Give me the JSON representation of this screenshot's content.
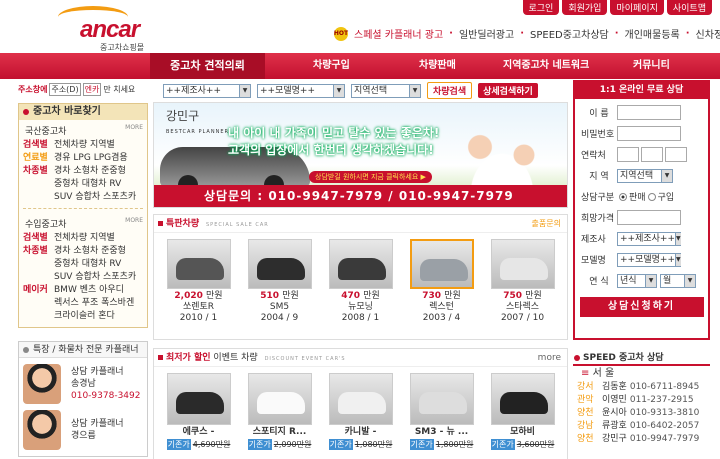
{
  "top_links": [
    "로그인",
    "회원가입",
    "마이페이지",
    "사이트맵"
  ],
  "logo": {
    "word": "ancar",
    "sub": "중고차쇼핑몰"
  },
  "header_links": {
    "hot_badge": "HOT",
    "special": "스페셜 카플래너 광고",
    "dealer": "일반딜러광고",
    "speed": "SPEED중고차상담",
    "personal": "개인매물등록",
    "newcar": "신차정보"
  },
  "nav": [
    "중고차 견적의뢰",
    "차량구입",
    "차량판매",
    "지역중고차 네트워크",
    "커뮤니티"
  ],
  "address_search": {
    "label": "주소창에",
    "tab1": "주소(D)",
    "name": "엔카",
    "tail": "만 치세요"
  },
  "left_panel": {
    "title": "중고차 바로찾기",
    "domestic": {
      "title": "국산중고차",
      "more": "MORE",
      "rows": [
        {
          "c": "검색별",
          "t": "전체차량 지역별",
          "cls": ""
        },
        {
          "c": "연료별",
          "t": "경유 LPG LPG겸용",
          "cls": "g"
        },
        {
          "c": "차종별",
          "t": "경차 소형차 준중형",
          "cls": ""
        },
        {
          "c": "",
          "t": "중형차 대형차 RV",
          "cls": "e"
        },
        {
          "c": "",
          "t": "SUV 승합차 스포츠카",
          "cls": "e"
        }
      ]
    },
    "imported": {
      "title": "수입중고차",
      "more": "MORE",
      "rows": [
        {
          "c": "검색별",
          "t": "전체차량 지역별",
          "cls": ""
        },
        {
          "c": "차종별",
          "t": "경차 소형차 준중형",
          "cls": ""
        },
        {
          "c": "",
          "t": "중형차 대형차 RV",
          "cls": "e"
        },
        {
          "c": "",
          "t": "SUV 승합차 스포츠카",
          "cls": "e"
        },
        {
          "c": "메이커",
          "t": "BMW 벤츠 아우디",
          "cls": ""
        },
        {
          "c": "",
          "t": "렉서스 푸조 폭스바겐",
          "cls": "e"
        },
        {
          "c": "",
          "t": "크라이슬러 혼다",
          "cls": "e"
        }
      ]
    }
  },
  "planner_box": {
    "title": "특장 / 화물차 전문 카플래너",
    "people": [
      {
        "role": "상담 카플래너",
        "name": "송경남",
        "phone": "010-9378-3492"
      },
      {
        "role": "상담 카플래너",
        "name": "경으름"
      }
    ]
  },
  "search": {
    "maker": "++제조사++",
    "model": "++모델명++",
    "region": "지역선택",
    "btn1": "차량검색",
    "btn2": "상세검색하기"
  },
  "banner": {
    "area": "강민구",
    "bestcar": "BESTCAR PLANNER",
    "slogan1": "내 아이 내 가족이 믿고 탈수 있는 좋은차!",
    "slogan2": "고객의 입장에서 한번더 생각하겠습니다!",
    "cta": "상담받길 원하시면 지금 클릭하세요 ▶",
    "phone": "상담문의 : 010-9947-7979 / 010-9947-7979"
  },
  "special": {
    "title": "특판차량",
    "en": "SPECIAL SALE CAR",
    "more": "출품문의",
    "cars": [
      {
        "price": "2,020",
        "unit": "만원",
        "name": "쏘렌토R",
        "date": "2010 / 1",
        "color": "#555"
      },
      {
        "price": "510",
        "unit": "만원",
        "name": "SM5",
        "date": "2004 / 9",
        "color": "#2d2d2d"
      },
      {
        "price": "470",
        "unit": "만원",
        "name": "뉴모닝",
        "date": "2008 / 1",
        "color": "#3a3a3a"
      },
      {
        "price": "730",
        "unit": "만원",
        "name": "렉스턴",
        "date": "2003 / 4",
        "color": "#9aa0a6"
      },
      {
        "price": "750",
        "unit": "만원",
        "name": "스타렉스",
        "date": "2007 / 10",
        "color": "#e6e6e6"
      }
    ]
  },
  "event": {
    "title1": "최저가 할인",
    "title2": "이벤트 차량",
    "en": "DISCOUNT EVENT CAR'S",
    "more": "more",
    "cars": [
      {
        "name": "에쿠스 -",
        "tag": "기존가",
        "old": "4,690만원",
        "color": "#2a2a2a"
      },
      {
        "name": "스포티지 R...",
        "tag": "기존가",
        "old": "2,090만원",
        "color": "#fafafa"
      },
      {
        "name": "카니발 -",
        "tag": "기존가",
        "old": "1,080만원",
        "color": "#f0f0f0"
      },
      {
        "name": "SM3 - 뉴 ...",
        "tag": "기존가",
        "old": "1,800만원",
        "color": "#ddd"
      },
      {
        "name": "모하비",
        "tag": "기존가",
        "old": "3,600만원",
        "color": "#222"
      }
    ]
  },
  "form": {
    "title": "1:1 온라인 무료 상담",
    "name": "이 름",
    "pw": "비밀번호",
    "contact": "연락처",
    "region": "지 역",
    "region_sel": "지역선택",
    "type": "상담구분",
    "sell": "판매",
    "buy": "구입",
    "price": "희망가격",
    "maker": "제조사",
    "maker_sel": "++제조사++",
    "model": "모델명",
    "model_sel": "++모델명++",
    "year": "연 식",
    "y_sel": "년식",
    "m_sel": "월",
    "submit": "상담신청하기"
  },
  "speed": {
    "title": "SPEED 중고차 상담",
    "region": "서 울",
    "rows": [
      {
        "a": "강서",
        "n": "김동훈",
        "p": "010-6711-8945"
      },
      {
        "a": "관악",
        "n": "이영민",
        "p": "011-237-2915"
      },
      {
        "a": "양천",
        "n": "윤시아",
        "p": "010-9313-3810"
      },
      {
        "a": "강남",
        "n": "류광호",
        "p": "010-6402-2057"
      },
      {
        "a": "양천",
        "n": "강민구",
        "p": "010-9947-7979"
      }
    ]
  },
  "colors": {
    "brand": "#c8102e",
    "accent": "#f39c12"
  }
}
